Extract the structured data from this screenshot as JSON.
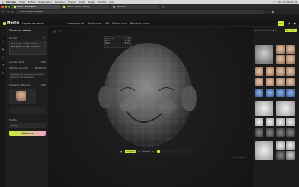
{
  "menubar": {
    "apple": "",
    "app": "Chrome",
    "items": [
      "Fichier",
      "Édition",
      "Présentation",
      "Historique",
      "Favoris",
      "Profils",
      "Onglet",
      "Fenêtre",
      "Aide"
    ],
    "status": "Mer. 28 mai 10:43"
  },
  "browser": {
    "tabs": [
      {
        "label": "Meshy Workspace",
        "active": true
      },
      {
        "label": "Meshy 3D Art Gallery",
        "active": false
      },
      {
        "label": "New Tab",
        "active": false
      }
    ],
    "url": "meshy.ai/workspace"
  },
  "app": {
    "brand": "Meshy",
    "workspace": "Espace de travail",
    "nav": [
      "Communauté",
      "Ressources",
      "API",
      "Ressources",
      "Rejoignez-nous"
    ],
    "credits": "Pro"
  },
  "generate_panel": {
    "title": "Texte vers Image",
    "prompt_label": "Prompt",
    "prompt_text": "Un visage animé de bébé, aux yeux fermés, souriant...",
    "ai_label": "Ajoutez de l'IA",
    "option_label": "Options de sortie",
    "option_value": "Par défaut",
    "note": "Générez des résultats variés à partir de votre prompt",
    "ref_label": "Image de référence",
    "model_label": "Modèle",
    "model_value": "Meshy-5",
    "generate_label": "Générer"
  },
  "canvas": {
    "info": [
      {
        "k": "Sommets",
        "v": "1,3M"
      },
      {
        "k": "Faces",
        "v": "2,6M"
      },
      {
        "k": "Taille",
        "v": "48 Mo"
      }
    ],
    "bottom": {
      "mode_a": "Sculpter",
      "mode_b": "Texture",
      "num": "12"
    },
    "hint": "Vue de face"
  },
  "right_panel": {
    "title": "Ressources récentes",
    "new_label": "Nouveau"
  }
}
